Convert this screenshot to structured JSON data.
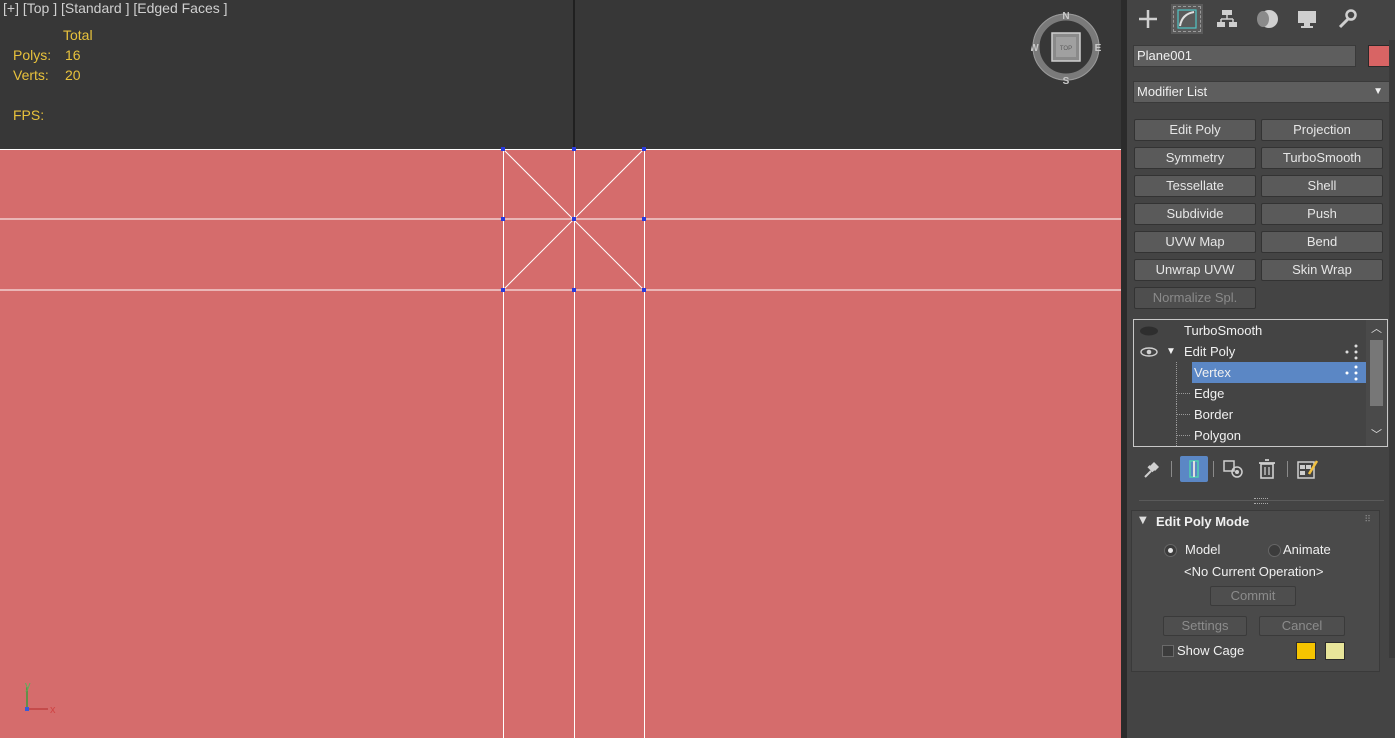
{
  "viewport": {
    "label": "[+] [Top ] [Standard ] [Edged Faces ]",
    "stats": {
      "total_label": "Total",
      "polys_label": "Polys:",
      "polys_value": "16",
      "verts_label": "Verts:",
      "verts_value": "20",
      "fps_label": "FPS:"
    },
    "viewcube": {
      "n": "N",
      "s": "S",
      "e": "E",
      "w": "W",
      "face": "TOP"
    },
    "axis": {
      "x": "x",
      "y": "y"
    },
    "colors": {
      "plane": "#d56c6c",
      "background": "#373737",
      "vertex": "#2b3bdc"
    }
  },
  "command_panel": {
    "tabs": [
      "create",
      "modify",
      "hierarchy",
      "motion",
      "display",
      "utilities"
    ],
    "object_name": "Plane001",
    "object_color": "#d86464",
    "modifier_list_label": "Modifier List",
    "modifier_buttons": [
      [
        "Edit Poly",
        "Projection"
      ],
      [
        "Symmetry",
        "TurboSmooth"
      ],
      [
        "Tessellate",
        "Shell"
      ],
      [
        "Subdivide",
        "Push"
      ],
      [
        "UVW Map",
        "Bend"
      ],
      [
        "Unwrap UVW",
        "Skin Wrap"
      ],
      [
        "Normalize Spl."
      ]
    ],
    "stack": {
      "items": [
        {
          "label": "TurboSmooth"
        },
        {
          "label": "Edit Poly"
        },
        {
          "label": "Vertex"
        },
        {
          "label": "Edge"
        },
        {
          "label": "Border"
        },
        {
          "label": "Polygon"
        }
      ],
      "selected": "Vertex"
    },
    "rollout": {
      "title": "Edit Poly Mode",
      "model_label": "Model",
      "animate_label": "Animate",
      "operation_text": "<No Current Operation>",
      "commit_label": "Commit",
      "settings_label": "Settings",
      "cancel_label": "Cancel",
      "show_cage_label": "Show Cage",
      "cage_color_1": "#f5c400",
      "cage_color_2": "#e8e59a"
    }
  }
}
